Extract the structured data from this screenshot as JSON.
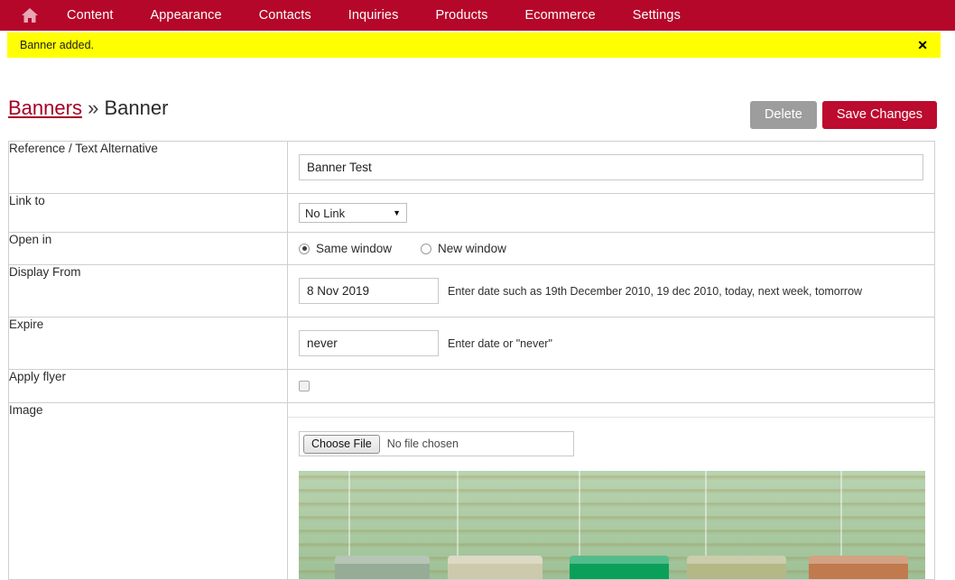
{
  "nav": {
    "home_icon": "home-icon",
    "items": [
      {
        "label": "Content"
      },
      {
        "label": "Appearance"
      },
      {
        "label": "Contacts"
      },
      {
        "label": "Inquiries"
      },
      {
        "label": "Products"
      },
      {
        "label": "Ecommerce"
      },
      {
        "label": "Settings"
      }
    ],
    "bg_color": "#b5072a"
  },
  "flash": {
    "message": "Banner added.",
    "close_label": "✕",
    "bg_color": "#ffff00"
  },
  "breadcrumb": {
    "parent": "Banners",
    "separator": "»",
    "current": "Banner"
  },
  "header_buttons": {
    "delete_label": "Delete",
    "delete_color": "#9d9d9d",
    "save_label": "Save Changes",
    "save_color": "#bd0a2f"
  },
  "form": {
    "reference": {
      "label": "Reference / Text Alternative",
      "value": "Banner Test",
      "placeholder": ""
    },
    "link_to": {
      "label": "Link to",
      "selected": "No Link",
      "options": [
        "No Link"
      ],
      "arrow": "▼"
    },
    "open_in": {
      "label": "Open in",
      "options": [
        {
          "label": "Same window",
          "selected": true
        },
        {
          "label": "New window",
          "selected": false
        }
      ]
    },
    "display_from": {
      "label": "Display From",
      "value": "8 Nov 2019",
      "hint": "Enter date such as 19th December 2010, 19 dec 2010, today, next week, tomorrow"
    },
    "expire": {
      "label": "Expire",
      "value": "never",
      "hint": "Enter date or \"never\""
    },
    "apply_flyer": {
      "label": "Apply flyer",
      "checked": false
    },
    "image": {
      "label": "Image",
      "choose_file_label": "Choose File",
      "file_status": "No file chosen"
    }
  }
}
